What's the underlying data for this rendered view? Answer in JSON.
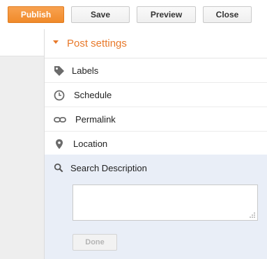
{
  "toolbar": {
    "publish_label": "Publish",
    "save_label": "Save",
    "preview_label": "Preview",
    "close_label": "Close"
  },
  "post_settings": {
    "title": "Post settings",
    "items": [
      {
        "label": "Labels",
        "icon": "tag-icon"
      },
      {
        "label": "Schedule",
        "icon": "clock-icon"
      },
      {
        "label": "Permalink",
        "icon": "link-icon"
      },
      {
        "label": "Location",
        "icon": "location-pin-icon"
      }
    ],
    "search_description": {
      "label": "Search Description",
      "icon": "search-icon",
      "value": "",
      "done_label": "Done"
    }
  },
  "colors": {
    "accent": "#e8792a",
    "publish_bg": "#f08a2a",
    "active_section_bg": "#e9eef7"
  }
}
